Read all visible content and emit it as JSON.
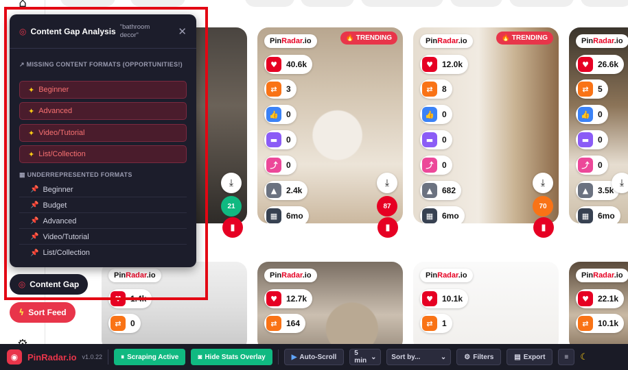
{
  "app": {
    "name": "PinRadar.io",
    "brand_prefix": "Pin",
    "brand_suffix": "Radar",
    "brand_tld": ".io",
    "version": "v1.0.22"
  },
  "colors": {
    "accent": "#e8354a",
    "panel_bg": "#1c1d2b",
    "bar_bg": "#1a1b26",
    "active_green": "#10b981"
  },
  "content_gap": {
    "title": "Content Gap Analysis",
    "query": "\"bathroom decor\"",
    "missing_heading": "MISSING CONTENT FORMATS (OPPORTUNITIES!)",
    "missing_items": [
      "Beginner",
      "Advanced",
      "Video/Tutorial",
      "List/Collection"
    ],
    "under_heading": "UNDERREPRESENTED FORMATS",
    "under_items": [
      "Beginner",
      "Budget",
      "Advanced",
      "Video/Tutorial",
      "List/Collection"
    ]
  },
  "left_buttons": {
    "content_gap": "Content Gap",
    "sort_feed": "Sort Feed"
  },
  "trending_label": "TRENDING",
  "pins": [
    {
      "stats": [],
      "score": "21",
      "score_color": "#10b981"
    },
    {
      "trending": true,
      "stats": [
        "40.6k",
        "3",
        "0",
        "0",
        "0",
        "2.4k",
        "6mo"
      ],
      "score": "87",
      "score_color": "#e60023"
    },
    {
      "trending": true,
      "stats": [
        "12.0k",
        "8",
        "0",
        "0",
        "0",
        "682",
        "6mo"
      ],
      "score": "70",
      "score_color": "#f97316"
    },
    {
      "stats": [
        "26.6k",
        "5",
        "0",
        "0",
        "0",
        "3.5k",
        "6mo"
      ],
      "score": "",
      "score_color": "#10b981"
    }
  ],
  "pins_row2": [
    {
      "stats": [
        "1.4k",
        "0"
      ]
    },
    {
      "stats": [
        "12.7k",
        "164"
      ]
    },
    {
      "stats": [
        "10.1k",
        "1"
      ]
    },
    {
      "stats": [
        "22.1k",
        "10.1k"
      ]
    }
  ],
  "toolbar": {
    "scraping": "Scraping Active",
    "hide_stats": "Hide Stats Overlay",
    "auto_scroll": "Auto-Scroll",
    "interval": "5 min",
    "sort": "Sort by...",
    "filters": "Filters",
    "export": "Export"
  }
}
